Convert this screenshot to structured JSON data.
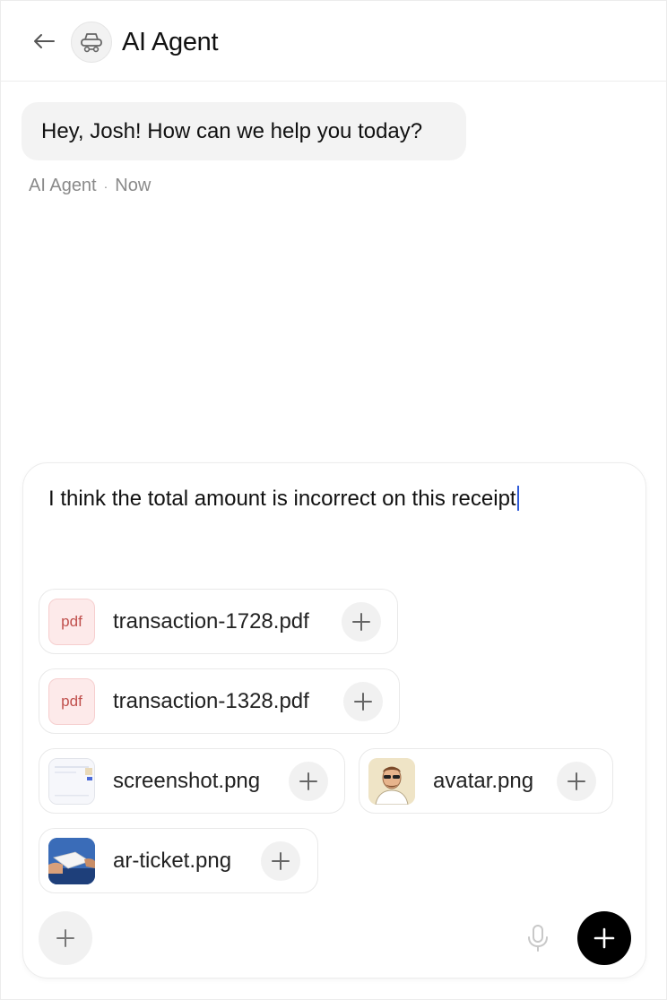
{
  "header": {
    "title": "AI Agent",
    "back_icon": "arrow-left-icon",
    "avatar_icon": "agent-robot-icon"
  },
  "messages": [
    {
      "text": "Hey, Josh! How can we help you today?",
      "sender": "AI Agent",
      "time": "Now"
    }
  ],
  "composer": {
    "value": "I think the total amount is incorrect on this receipt",
    "attachments": [
      {
        "name": "transaction-1728.pdf",
        "type": "pdf",
        "badge": "pdf"
      },
      {
        "name": "transaction-1328.pdf",
        "type": "pdf",
        "badge": "pdf"
      },
      {
        "name": "screenshot.png",
        "type": "image"
      },
      {
        "name": "avatar.png",
        "type": "image"
      },
      {
        "name": "ar-ticket.png",
        "type": "image"
      }
    ]
  },
  "colors": {
    "accent": "#000000",
    "bubble": "#f3f3f3",
    "pdf_bg": "#fdeaea",
    "caret": "#2f5bd8"
  }
}
